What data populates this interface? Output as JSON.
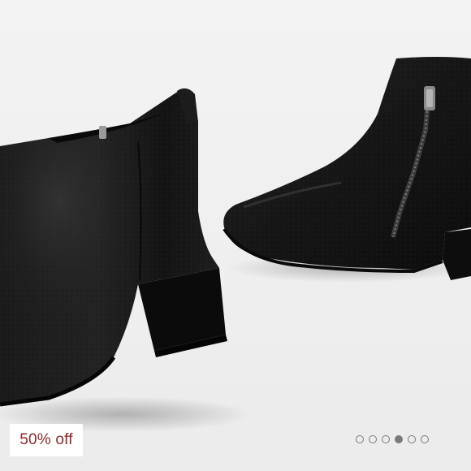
{
  "product_image": {
    "subject": "black-leather-ankle-boots",
    "accent": "#8b2a2a",
    "background": "#efefef"
  },
  "badge": {
    "label": "50% off"
  },
  "carousel": {
    "total": 6,
    "active_index": 3
  }
}
